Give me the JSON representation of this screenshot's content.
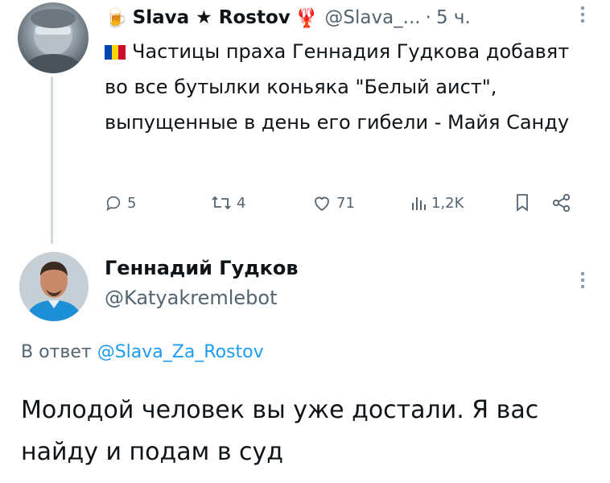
{
  "tweet": {
    "author_emoji": "🍺",
    "author_name": "Slava ★ Rostov",
    "author_badge": "🦞",
    "handle": "@Slava_...",
    "separator": "·",
    "time": "5 ч.",
    "more": "⋮",
    "flag_colors": [
      "#0046ae",
      "#ffd200",
      "#cc092f"
    ],
    "text": "Частицы праха Геннадия Гудкова добавят во все бутылки коньяка \"Белый аист\", выпущенные в день его гибели - Майя Санду",
    "actions": {
      "replies": "5",
      "reposts": "4",
      "likes": "71",
      "views": "1,2K"
    }
  },
  "reply": {
    "author_name": "Геннадий Гудков",
    "handle": "@Katyakremlebot",
    "more": "⋮",
    "reply_prefix": "В ответ",
    "reply_mention": "@Slava_Za_Rostov",
    "text": "Молодой человек вы уже достали. Я вас найду и подам в суд"
  },
  "colors": {
    "text_primary": "#0f1419",
    "text_secondary": "#536471",
    "link": "#1d9bf0"
  }
}
